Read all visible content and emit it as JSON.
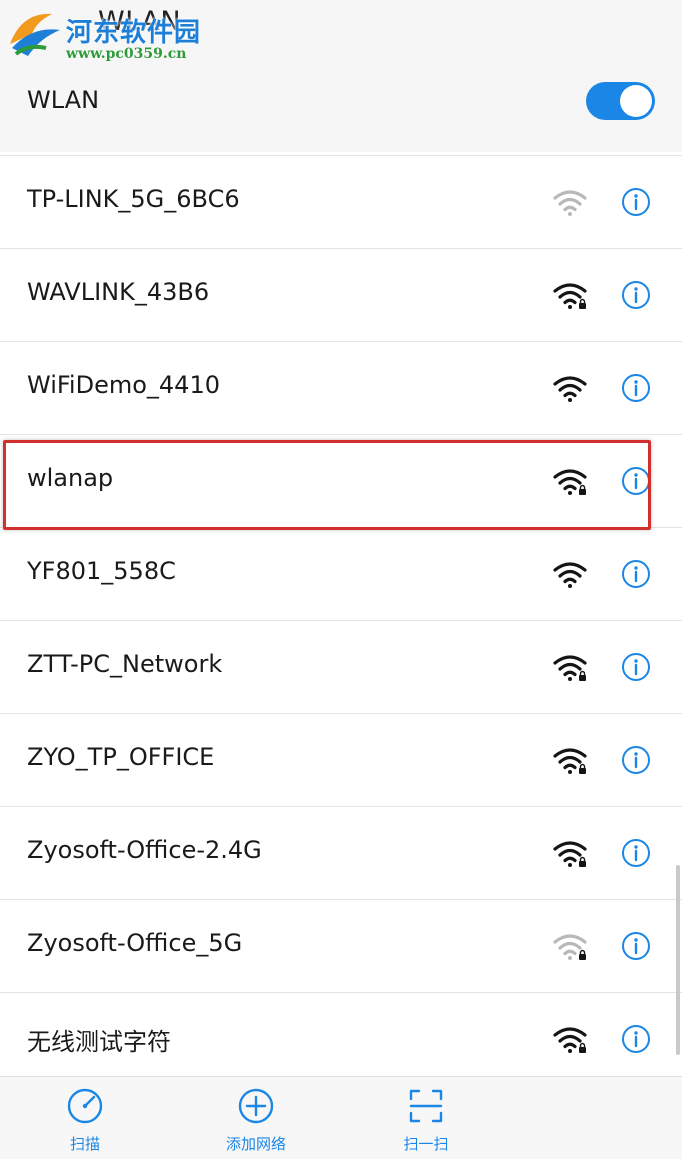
{
  "header": {
    "title": "WLAN",
    "watermark": {
      "site_name": "河东软件园",
      "url": "www.pc0359.cn"
    }
  },
  "wlan_toggle": {
    "label": "WLAN",
    "enabled": true
  },
  "networks": [
    {
      "ssid": "TP-LINK_5G_6BC6",
      "secured": false,
      "signal": "medium"
    },
    {
      "ssid": "WAVLINK_43B6",
      "secured": true,
      "signal": "strong"
    },
    {
      "ssid": "WiFiDemo_4410",
      "secured": false,
      "signal": "strong"
    },
    {
      "ssid": "wlanap",
      "secured": true,
      "signal": "strong",
      "highlighted": true
    },
    {
      "ssid": "YF801_558C",
      "secured": false,
      "signal": "strong"
    },
    {
      "ssid": "ZTT-PC_Network",
      "secured": true,
      "signal": "strong"
    },
    {
      "ssid": "ZYO_TP_OFFICE",
      "secured": true,
      "signal": "strong"
    },
    {
      "ssid": "Zyosoft-Office-2.4G",
      "secured": true,
      "signal": "strong"
    },
    {
      "ssid": "Zyosoft-Office_5G",
      "secured": true,
      "signal": "medium"
    },
    {
      "ssid": "无线测试字符",
      "secured": true,
      "signal": "strong"
    }
  ],
  "bottom_bar": {
    "scan_label": "扫描",
    "add_network_label": "添加网络",
    "qr_scan_label": "扫一扫"
  },
  "colors": {
    "accent": "#1a86e6",
    "highlight": "#d0312d"
  },
  "icons": {
    "wifi": "wifi-signal-icon",
    "lock": "lock-icon",
    "info": "info-icon",
    "scan": "radar-icon",
    "add": "plus-circle-icon",
    "qr": "scan-frame-icon"
  }
}
